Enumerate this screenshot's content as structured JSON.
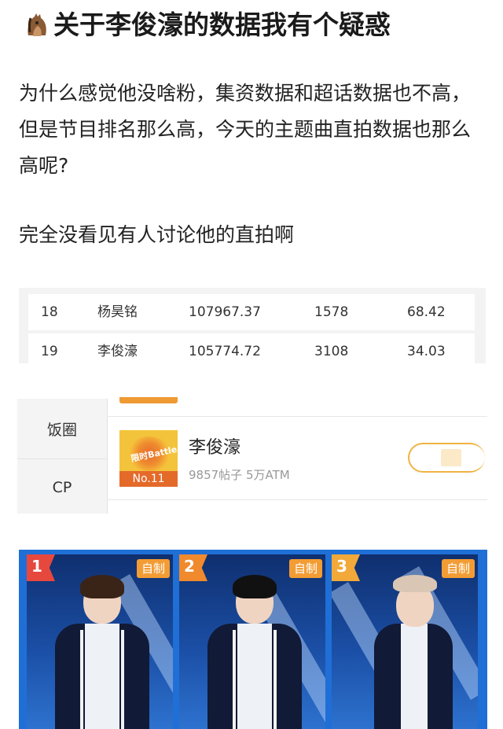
{
  "post": {
    "title": "关于李俊濠的数据我有个疑惑",
    "title_icon": "horse-face-icon",
    "paragraph1": "为什么感觉他没啥粉，集资数据和超话数据也不高，但是节目排名那么高，今天的主题曲直拍数据也那么高呢?",
    "paragraph2": "完全没看见有人讨论他的直拍啊"
  },
  "ranking_table": {
    "rows": [
      {
        "rank": "18",
        "name": "杨昊铭",
        "value1": "107967.37",
        "value2": "1578",
        "value3": "68.42"
      },
      {
        "rank": "19",
        "name": "李俊濠",
        "value1": "105774.72",
        "value2": "3108",
        "value3": "34.03"
      }
    ]
  },
  "supertopic": {
    "tabs": [
      "饭圈",
      "CP"
    ],
    "thumbnail_rank": "No.11",
    "thumbnail_text": "限时Battle",
    "name": "李俊濠",
    "stats": "9857帖子 5万ATM",
    "accent_color": "#f0b342"
  },
  "performance_cards": [
    {
      "rank": "1",
      "badge": "自制"
    },
    {
      "rank": "2",
      "badge": "自制"
    },
    {
      "rank": "3",
      "badge": "自制"
    }
  ],
  "colors": {
    "card_background": "#1f6fd6",
    "badge_orange": "#f39c34",
    "rank1": "#e6483d"
  }
}
